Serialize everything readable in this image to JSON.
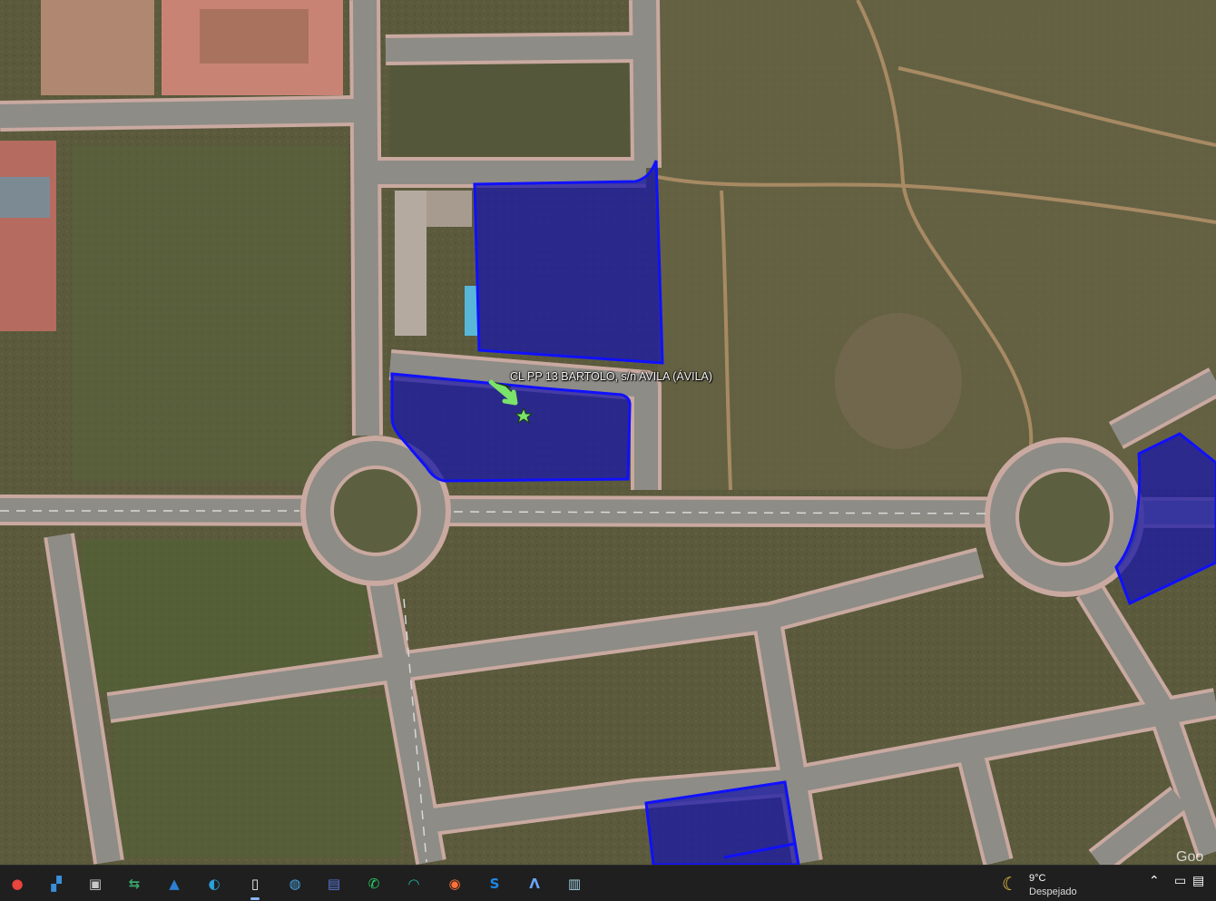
{
  "map": {
    "placemark_label": "CL PP 13 BARTOLO, s/n AVILA (ÁVILA)",
    "watermark": "Goo",
    "colors": {
      "parcel_fill": "#1a1aa6",
      "parcel_stroke": "#1010ff",
      "road": "#8d8c86",
      "curb": "#c9a9a0",
      "grass": "#5b5a3d",
      "pin": "#7be36a"
    }
  },
  "taskbar": {
    "apps": [
      {
        "name": "chrome-icon",
        "glyph": "●",
        "color": "#e8453c"
      },
      {
        "name": "maps-app-icon",
        "glyph": "▞",
        "color": "#3b8ed8"
      },
      {
        "name": "snip-icon",
        "glyph": "▣",
        "color": "#c8c8c8"
      },
      {
        "name": "share-icon",
        "glyph": "⇆",
        "color": "#3aa86b"
      },
      {
        "name": "photos-icon",
        "glyph": "▲",
        "color": "#2d7fd2"
      },
      {
        "name": "edge-icon",
        "glyph": "◐",
        "color": "#2aa1d8"
      },
      {
        "name": "document-icon",
        "glyph": "▯",
        "color": "#f5f5f5"
      },
      {
        "name": "globe-icon",
        "glyph": "◍",
        "color": "#4aa3df"
      },
      {
        "name": "save-icon",
        "glyph": "▤",
        "color": "#5a7bd8"
      },
      {
        "name": "whatsapp-icon",
        "glyph": "✆",
        "color": "#25d366"
      },
      {
        "name": "wireless-app-icon",
        "glyph": "◠",
        "color": "#1fb4a0"
      },
      {
        "name": "firefox-icon",
        "glyph": "◉",
        "color": "#ff7139"
      },
      {
        "name": "s-app-icon",
        "glyph": "S",
        "color": "#1e88e5"
      },
      {
        "name": "a-app-icon",
        "glyph": "Λ",
        "color": "#6aa6ff"
      },
      {
        "name": "window-app-icon",
        "glyph": "▥",
        "color": "#9fd0e0"
      }
    ],
    "weather": {
      "icon": "moon-icon",
      "temp": "9°C",
      "condition": "Despejado"
    },
    "tray": [
      {
        "name": "chevron-up-icon",
        "glyph": "⌃"
      },
      {
        "name": "display-icon",
        "glyph": "▭"
      },
      {
        "name": "network-icon",
        "glyph": "▤"
      },
      {
        "name": "volume-icon",
        "glyph": "◖"
      }
    ]
  }
}
